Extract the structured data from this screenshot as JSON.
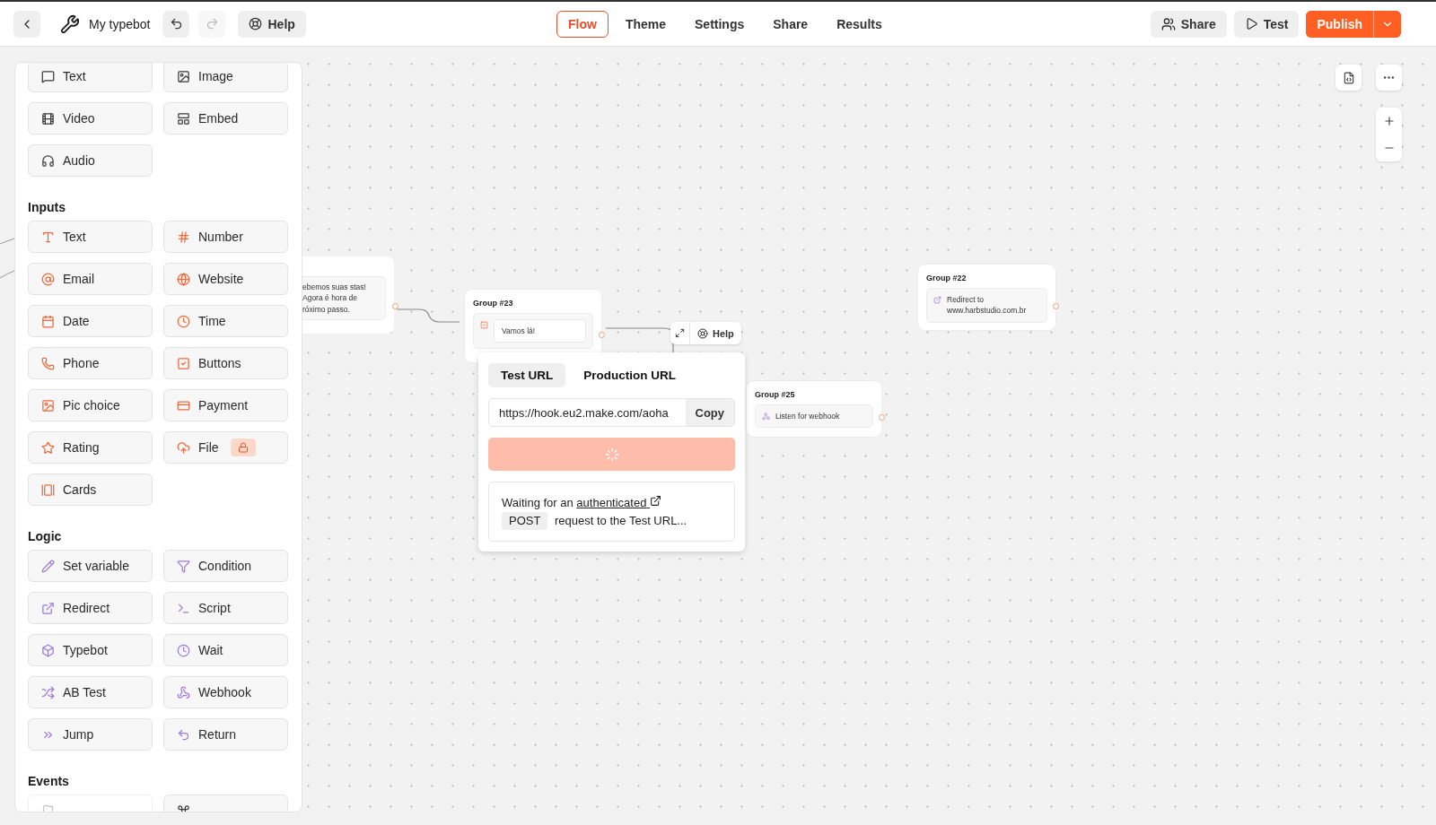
{
  "header": {
    "title": "My typebot",
    "help": "Help",
    "tabs": [
      {
        "label": "Flow",
        "selected": true
      },
      {
        "label": "Theme",
        "selected": false
      },
      {
        "label": "Settings",
        "selected": false
      },
      {
        "label": "Share",
        "selected": false
      },
      {
        "label": "Results",
        "selected": false
      }
    ],
    "share": "Share",
    "test": "Test",
    "publish": "Publish"
  },
  "sidebar": {
    "sections": [
      {
        "items": [
          {
            "label": "Text"
          },
          {
            "label": "Image"
          },
          {
            "label": "Video"
          },
          {
            "label": "Embed"
          },
          {
            "label": "Audio"
          }
        ]
      },
      {
        "heading": "Inputs",
        "items": [
          {
            "label": "Text"
          },
          {
            "label": "Number"
          },
          {
            "label": "Email"
          },
          {
            "label": "Website"
          },
          {
            "label": "Date"
          },
          {
            "label": "Time"
          },
          {
            "label": "Phone"
          },
          {
            "label": "Buttons"
          },
          {
            "label": "Pic choice"
          },
          {
            "label": "Payment"
          },
          {
            "label": "Rating"
          },
          {
            "label": "File",
            "locked": true
          },
          {
            "label": "Cards"
          }
        ]
      },
      {
        "heading": "Logic",
        "items": [
          {
            "label": "Set variable"
          },
          {
            "label": "Condition"
          },
          {
            "label": "Redirect"
          },
          {
            "label": "Script"
          },
          {
            "label": "Typebot"
          },
          {
            "label": "Wait"
          },
          {
            "label": "AB Test"
          },
          {
            "label": "Webhook"
          },
          {
            "label": "Jump"
          },
          {
            "label": "Return"
          }
        ]
      },
      {
        "heading": "Events",
        "items": [
          {
            "disabled": true
          },
          {
            "disabled": false
          }
        ]
      }
    ]
  },
  "canvas": {
    "partial_group": {
      "text": "ebemos suas stas! Agora é hora de róximo passo."
    },
    "groups": [
      {
        "title": "Group #23",
        "block": "Vamos lá!"
      },
      {
        "title": "Group #22",
        "block": "Redirect to www.harbstudio.com.br"
      },
      {
        "title": "Group #25",
        "block": "Listen for webhook"
      }
    ],
    "toolbar": {
      "help": "Help"
    },
    "popover": {
      "tabs": [
        {
          "label": "Test URL",
          "selected": true
        },
        {
          "label": "Production URL",
          "selected": false
        }
      ],
      "url": "https://hook.eu2.make.com/aoha",
      "copy": "Copy",
      "message": {
        "before": "Waiting for an",
        "link": "authenticated",
        "method": "POST",
        "after": "request to the Test URL..."
      }
    }
  }
}
